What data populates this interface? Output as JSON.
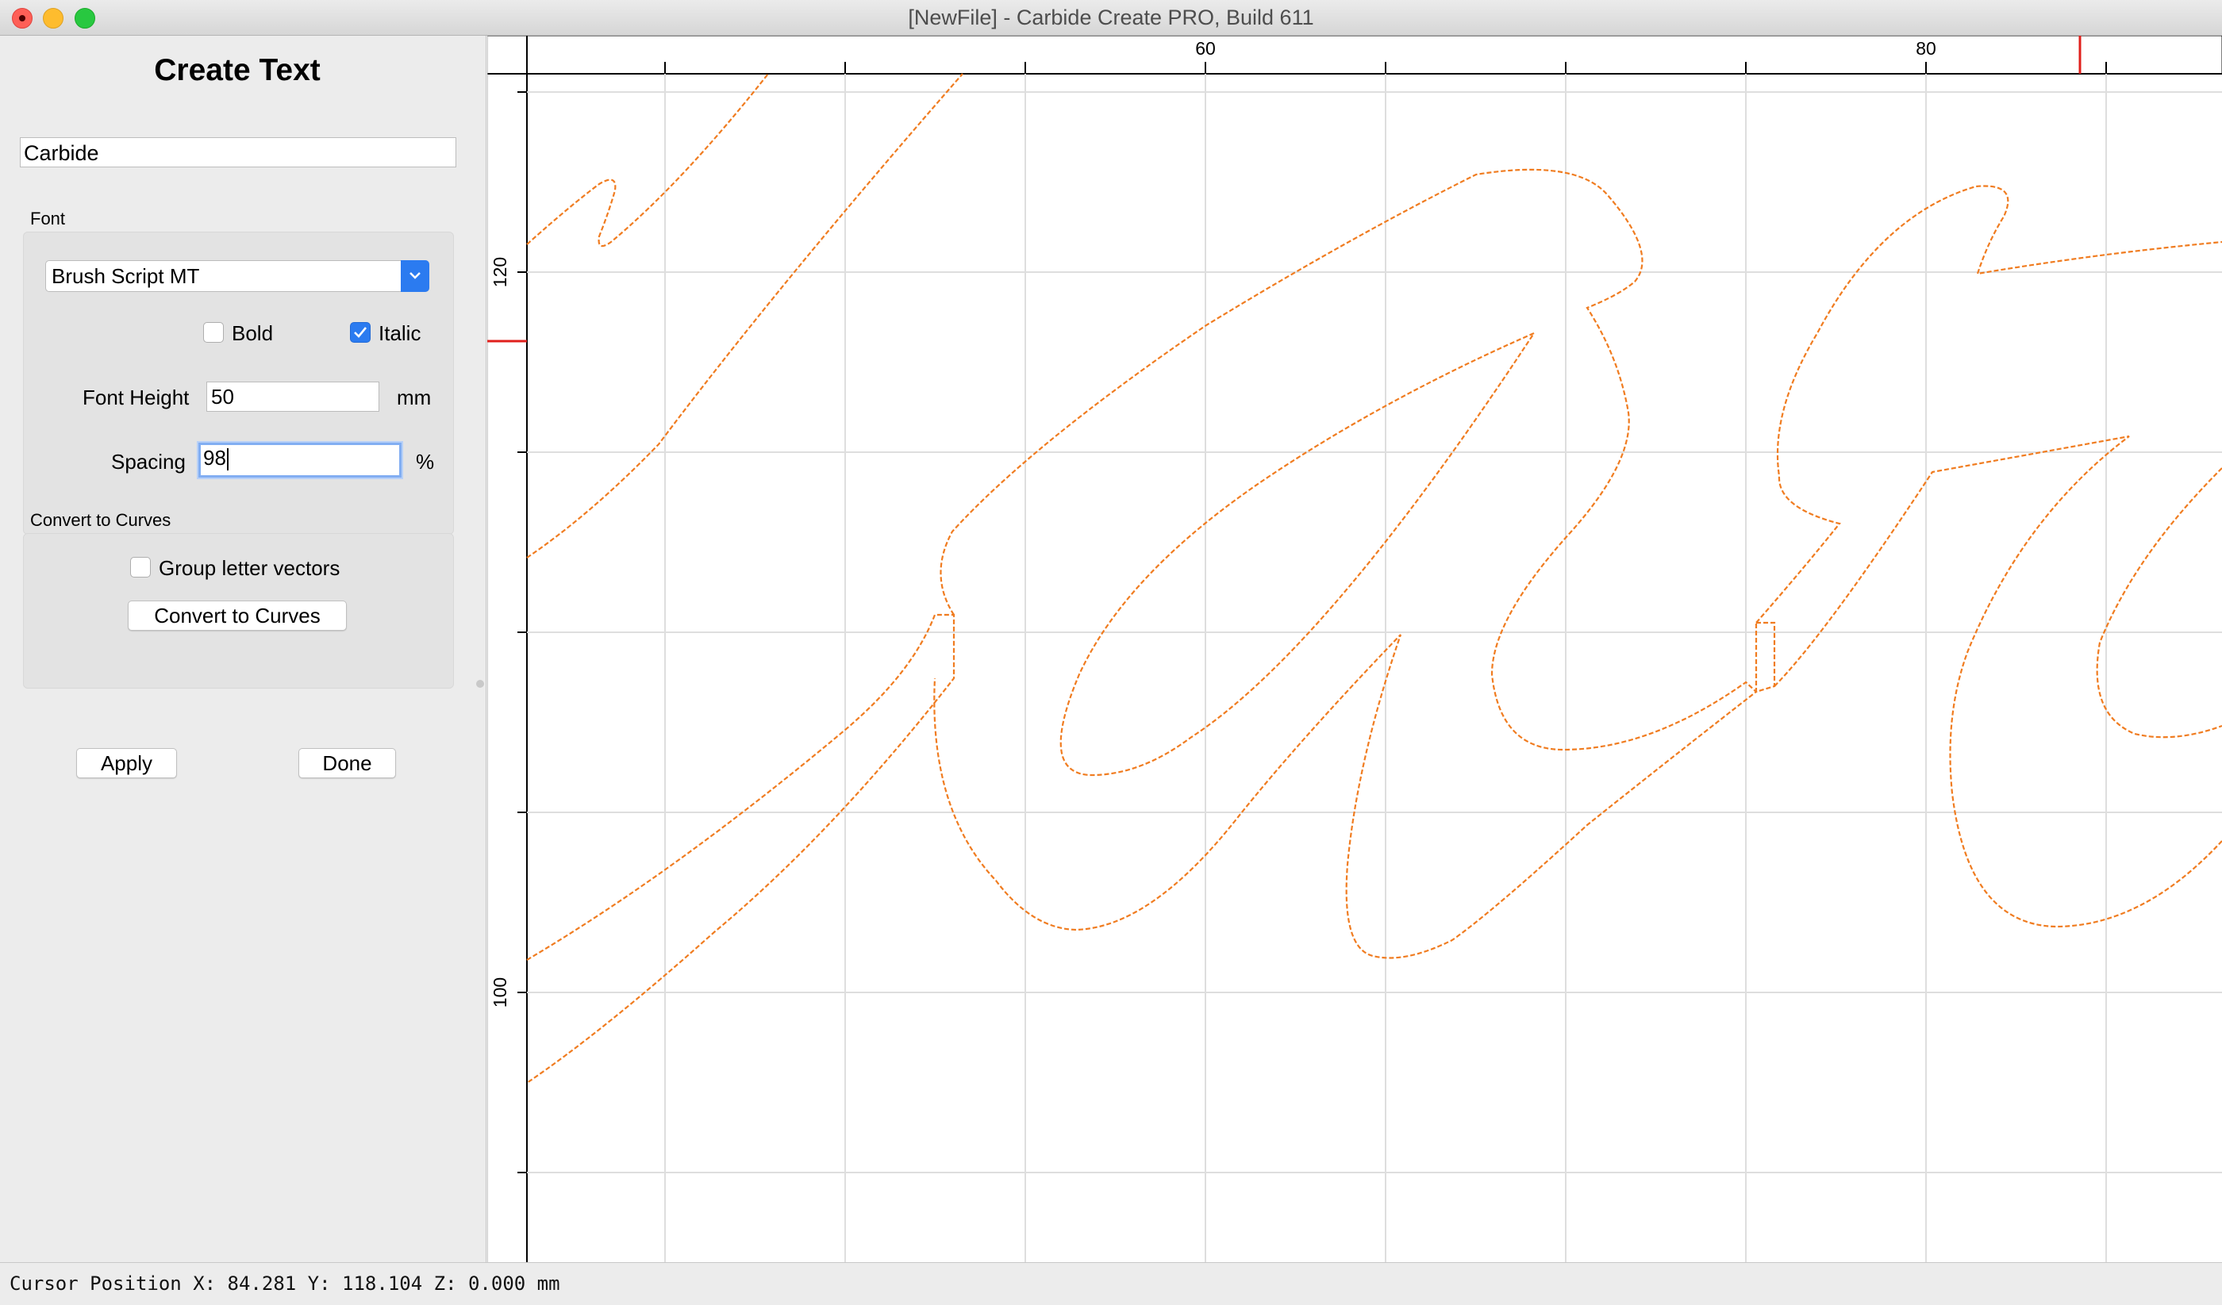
{
  "window": {
    "title": "[NewFile] - Carbide Create PRO, Build 611"
  },
  "panel": {
    "title": "Create Text",
    "text_value": "Carbide",
    "font_section": "Font",
    "font_name": "Brush Script MT",
    "bold": {
      "label": "Bold",
      "checked": false
    },
    "italic": {
      "label": "Italic",
      "checked": true
    },
    "font_height": {
      "label": "Font Height",
      "value": "50",
      "unit": "mm"
    },
    "spacing": {
      "label": "Spacing",
      "value": "98",
      "unit": "%"
    },
    "convert_section": "Convert to Curves",
    "group_vectors": {
      "label": "Group letter vectors",
      "checked": false
    },
    "convert_button": "Convert to Curves",
    "apply_button": "Apply",
    "done_button": "Done"
  },
  "rulers": {
    "top_labels": [
      "60",
      "80"
    ],
    "left_labels": [
      "120",
      "100"
    ]
  },
  "colors": {
    "vector": "#f07c20",
    "grid": "#dedede",
    "marker": "#e0201c",
    "accent": "#2b7bf0"
  },
  "status": {
    "cursor_text": "Cursor Position X: 84.281 Y: 118.104 Z: 0.000 mm"
  }
}
